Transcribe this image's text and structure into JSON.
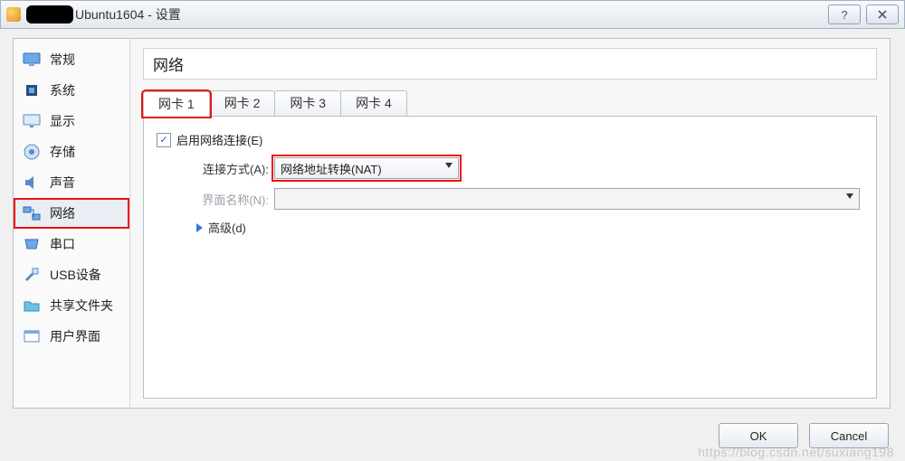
{
  "title": "Ubuntu1604 - 设置",
  "sidebar": {
    "items": [
      {
        "label": "常规"
      },
      {
        "label": "系统"
      },
      {
        "label": "显示"
      },
      {
        "label": "存储"
      },
      {
        "label": "声音"
      },
      {
        "label": "网络"
      },
      {
        "label": "串口"
      },
      {
        "label": "USB设备"
      },
      {
        "label": "共享文件夹"
      },
      {
        "label": "用户界面"
      }
    ]
  },
  "section_title": "网络",
  "tabs": [
    {
      "label": "网卡 1"
    },
    {
      "label": "网卡 2"
    },
    {
      "label": "网卡 3"
    },
    {
      "label": "网卡 4"
    }
  ],
  "form": {
    "enable_label": "启用网络连接(E)",
    "enable_checked": true,
    "attached_label": "连接方式(A):",
    "attached_value": "网络地址转换(NAT)",
    "iface_label": "界面名称(N):",
    "iface_value": "",
    "advanced_label": "高级(d)"
  },
  "buttons": {
    "ok": "OK",
    "cancel": "Cancel"
  },
  "watermark": "https://blog.csdn.net/suxiang198",
  "colors": {
    "accent": "#2e7bd6",
    "highlight": "#e11"
  }
}
